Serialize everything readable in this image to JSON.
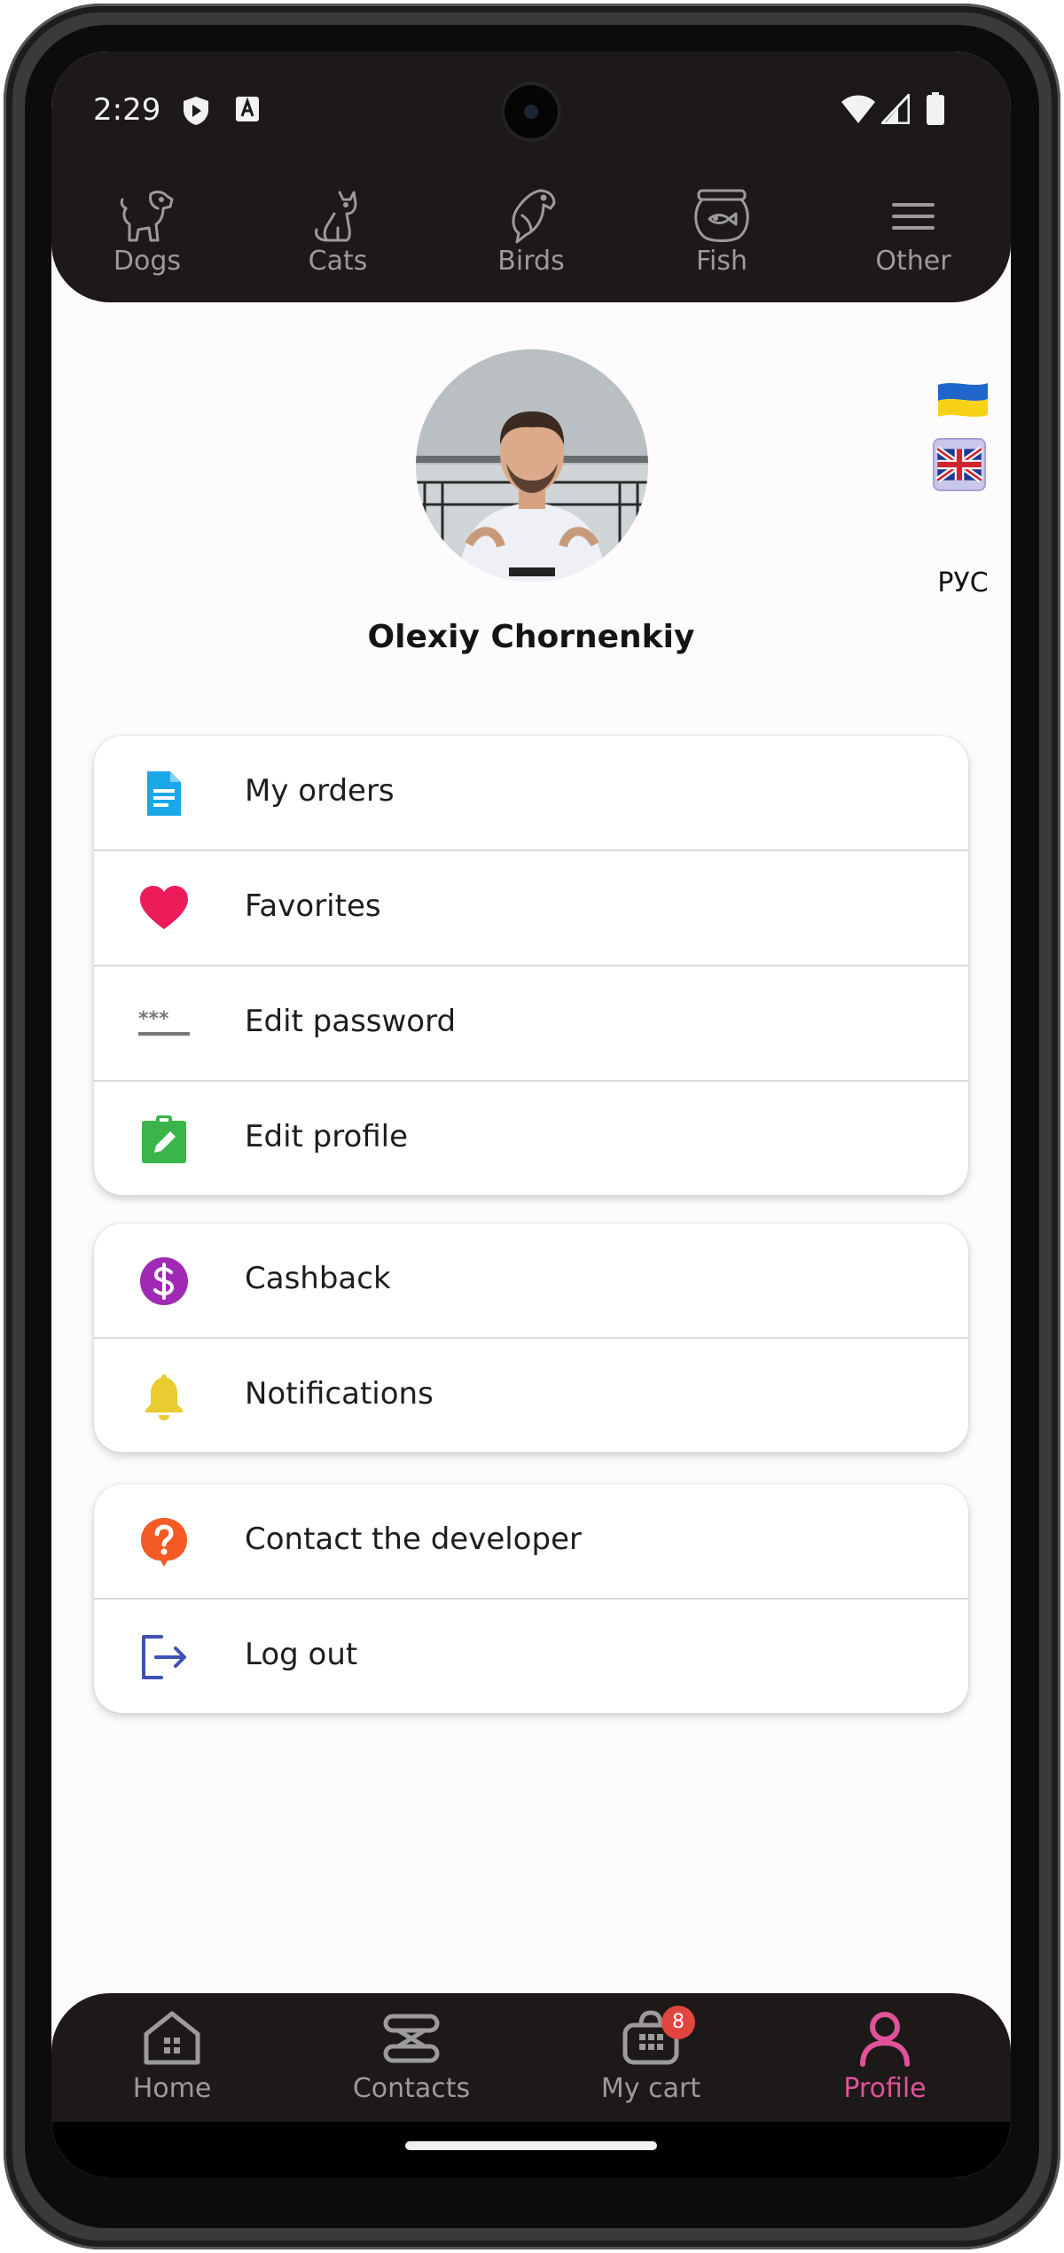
{
  "status_bar": {
    "time": "2:29",
    "left_icons": [
      "shield-play-icon",
      "font-a-icon"
    ],
    "right_icons": [
      "wifi-icon",
      "cell-signal-icon",
      "battery-icon"
    ]
  },
  "categories": [
    {
      "label": "Dogs",
      "icon": "dog-icon"
    },
    {
      "label": "Cats",
      "icon": "cat-icon"
    },
    {
      "label": "Birds",
      "icon": "bird-icon"
    },
    {
      "label": "Fish",
      "icon": "fish-icon"
    },
    {
      "label": "Other",
      "icon": "menu-icon"
    }
  ],
  "profile": {
    "name": "Olexiy Chornenkiy",
    "avatar": "user-photo"
  },
  "language": {
    "flags": [
      "ukraine-flag",
      "uk-flag"
    ],
    "ru_label": "РУС"
  },
  "menu_groups": [
    [
      {
        "label": "My orders",
        "icon": "document-icon",
        "color": "#1aa7e8"
      },
      {
        "label": "Favorites",
        "icon": "heart-icon",
        "color": "#ec1c5b"
      },
      {
        "label": "Edit password",
        "icon": "password-icon",
        "color": "#777777"
      },
      {
        "label": "Edit profile",
        "icon": "clipboard-edit-icon",
        "color": "#3bb44a"
      }
    ],
    [
      {
        "label": "Cashback",
        "icon": "dollar-icon",
        "color": "#a02ab5"
      },
      {
        "label": "Notifications",
        "icon": "bell-icon",
        "color": "#e9cc2f"
      }
    ],
    [
      {
        "label": "Contact the developer",
        "icon": "help-icon",
        "color": "#f35a24"
      },
      {
        "label": "Log out",
        "icon": "logout-icon",
        "color": "#3f51b5"
      }
    ]
  ],
  "bottom_nav": [
    {
      "label": "Home",
      "icon": "home-icon",
      "active": false
    },
    {
      "label": "Contacts",
      "icon": "contacts-icon",
      "active": false
    },
    {
      "label": "My cart",
      "icon": "cart-icon",
      "active": false,
      "badge": "8"
    },
    {
      "label": "Profile",
      "icon": "profile-icon",
      "active": true
    }
  ],
  "colors": {
    "bar_bg": "#1c1918",
    "accent": "#e0529a",
    "inactive": "#9d9b9a",
    "screen_bg": "#fdfbfc"
  }
}
